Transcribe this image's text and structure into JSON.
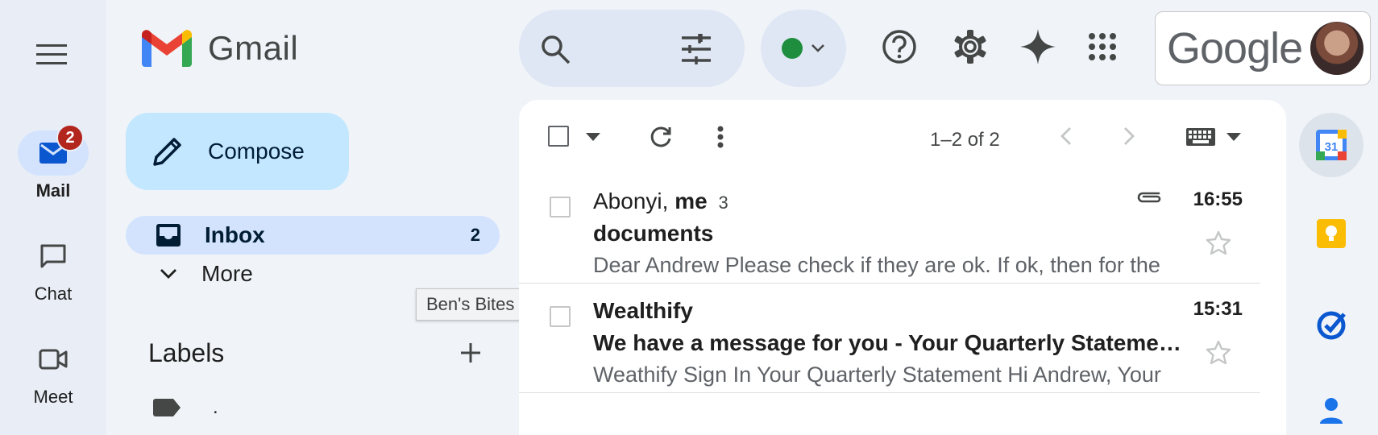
{
  "app": {
    "logo_text": "Gmail"
  },
  "rail": {
    "items": [
      {
        "label": "Mail",
        "badge": "2",
        "icon": "mail-icon"
      },
      {
        "label": "Chat",
        "icon": "chat-icon"
      },
      {
        "label": "Meet",
        "icon": "video-icon"
      }
    ]
  },
  "header": {
    "status_color": "#1e8e3e",
    "account_brand": "Google"
  },
  "compose": {
    "label": "Compose"
  },
  "nav": {
    "inbox": {
      "label": "Inbox",
      "count": "2"
    },
    "more": {
      "label": "More"
    }
  },
  "labels": {
    "title": "Labels",
    "items": [
      {
        "name": "."
      }
    ]
  },
  "tooltip": {
    "text": "Ben's Bites"
  },
  "toolbar": {
    "page_info": "1–2 of 2"
  },
  "emails": [
    {
      "sender_plain": "Abonyi,",
      "sender_bold": "me",
      "thread_count": "3",
      "subject": "documents",
      "snippet": "Dear Andrew Please check if they are ok. If ok, then for the",
      "time": "16:55",
      "has_attachment": true
    },
    {
      "sender_plain": "",
      "sender_bold": "Wealthify",
      "thread_count": "",
      "subject": "We have a message for you - Your Quarterly Statement is ready",
      "snippet": "Weathify Sign In Your Quarterly Statement Hi Andrew, Your",
      "time": "15:31",
      "has_attachment": false
    }
  ],
  "side_panel": {
    "items": [
      "calendar-icon",
      "keep-icon",
      "tasks-icon",
      "contacts-icon"
    ]
  }
}
